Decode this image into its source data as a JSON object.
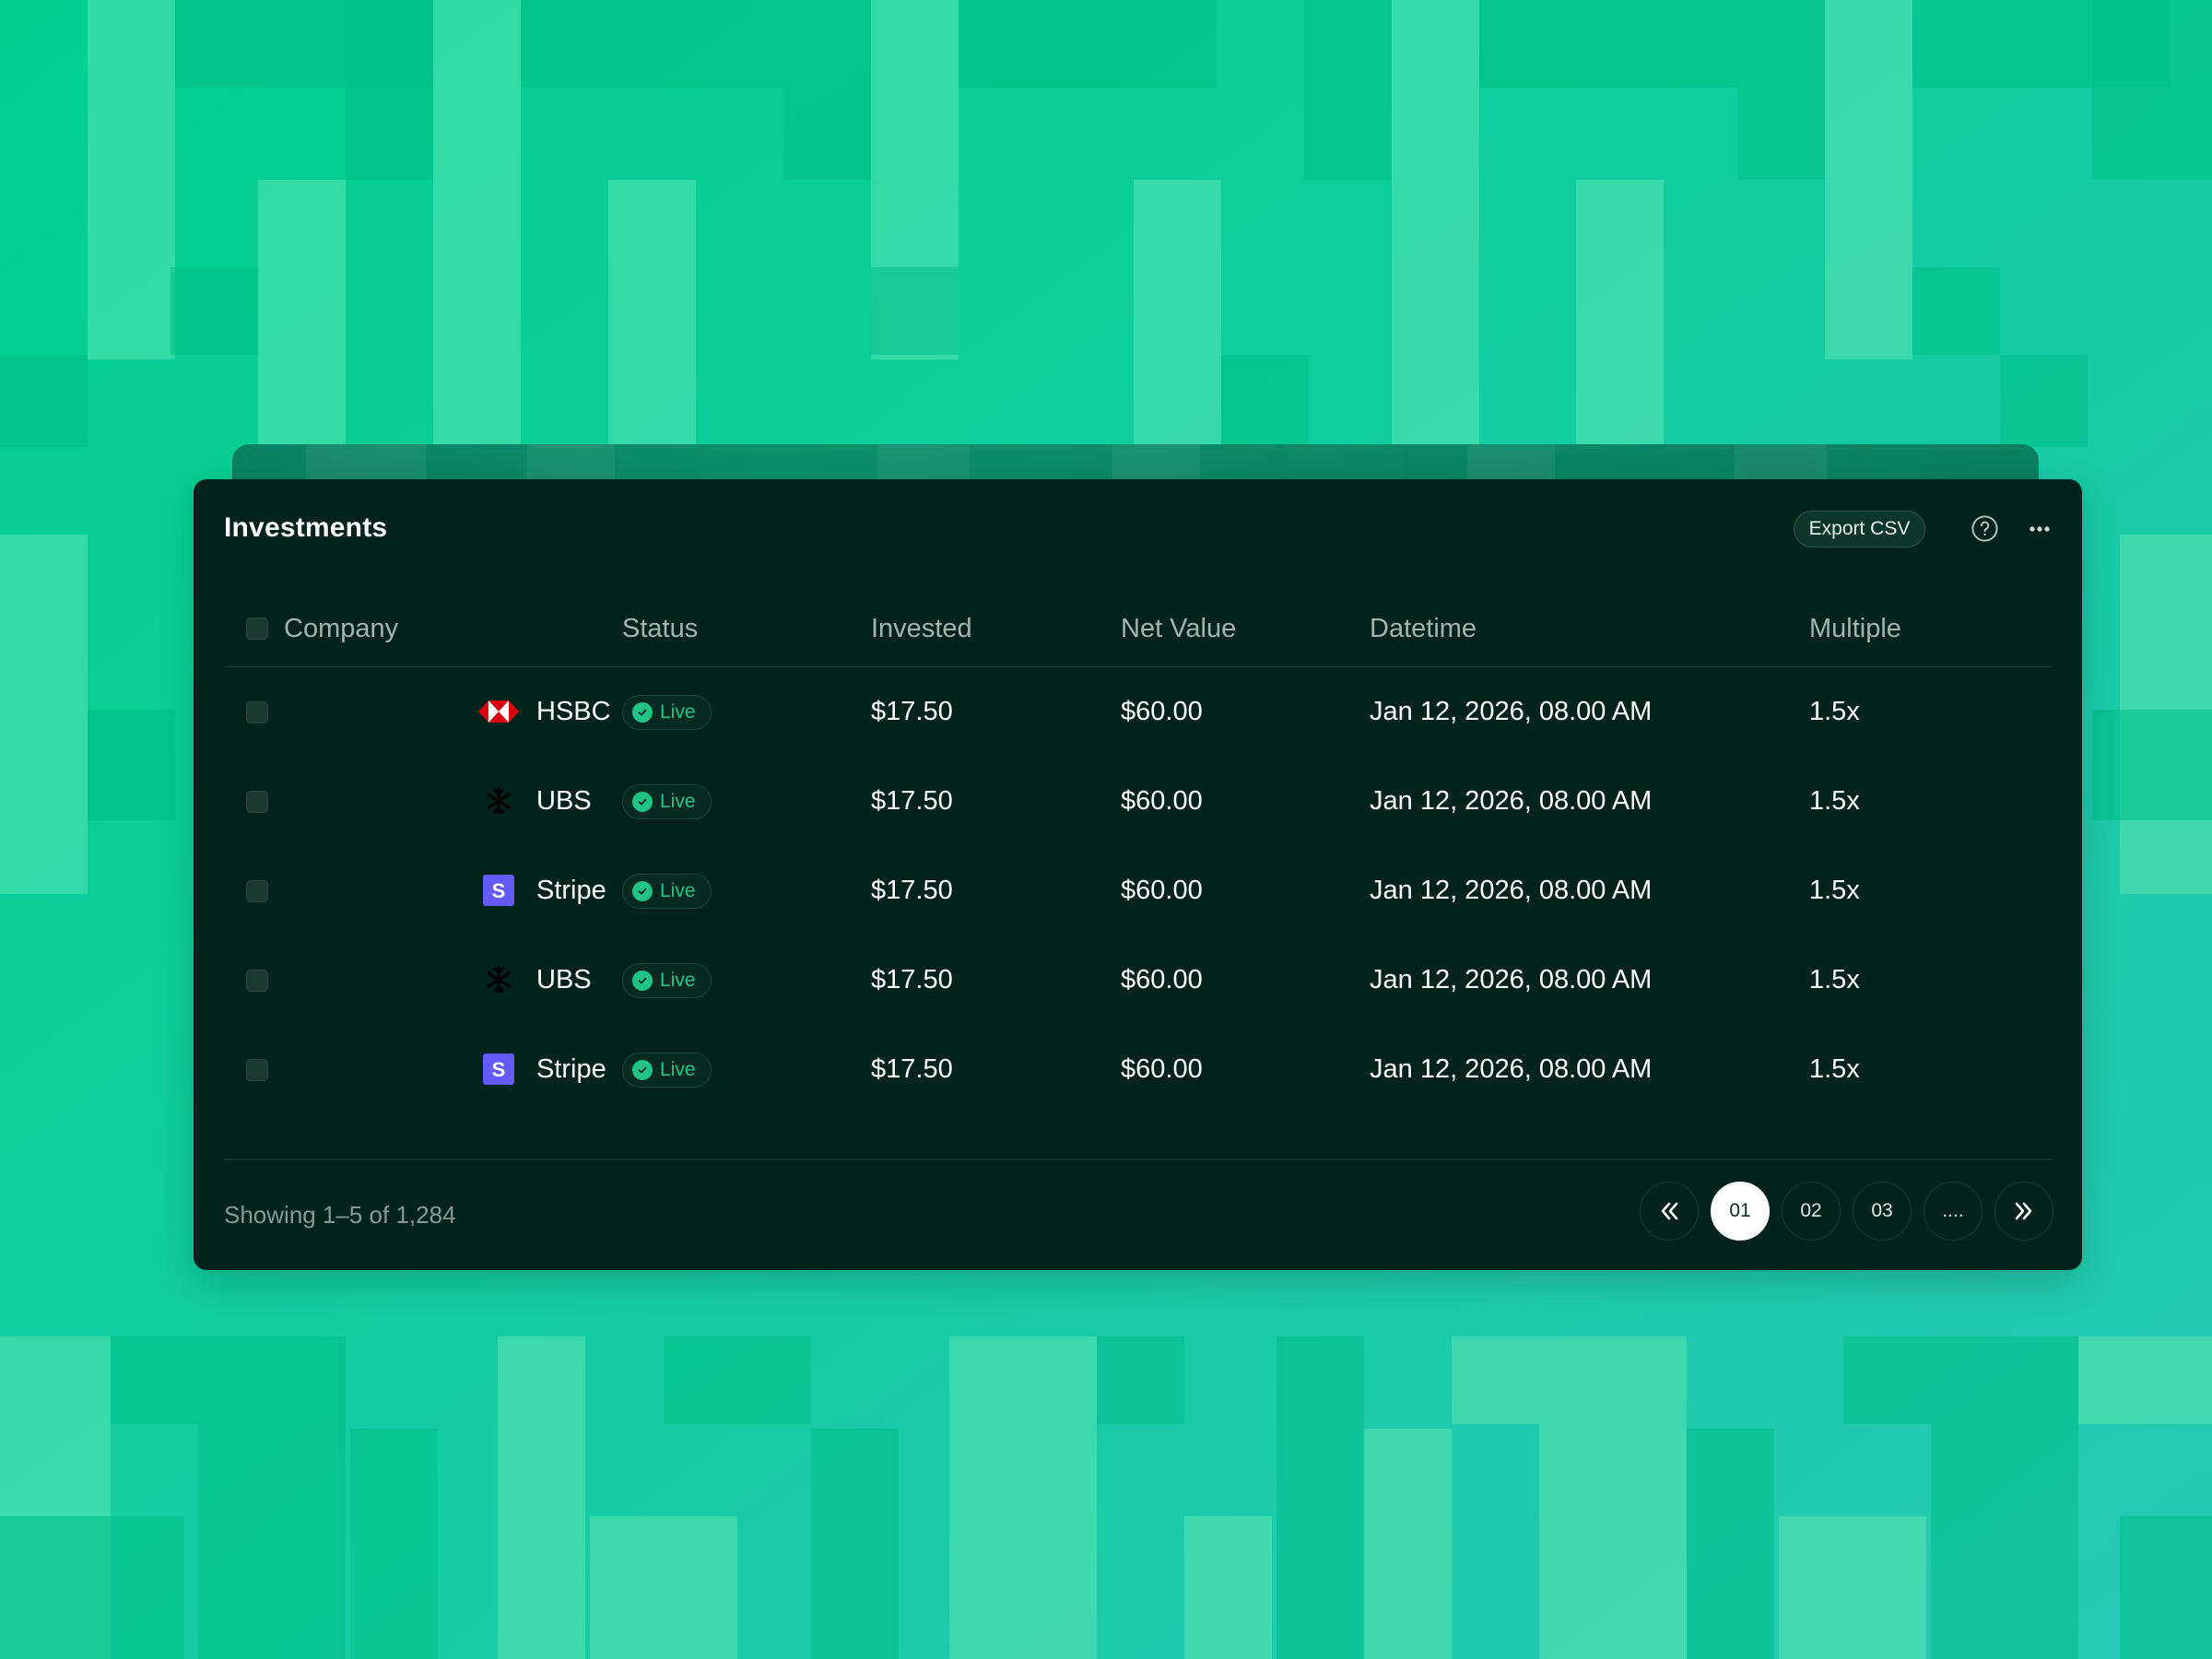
{
  "card": {
    "title": "Investments",
    "export_label": "Export CSV",
    "help_icon": "help-circle-icon",
    "more_icon": "more-horizontal-icon"
  },
  "table": {
    "columns": [
      "Company",
      "Status",
      "Invested",
      "Net Value",
      "Datetime",
      "Multiple"
    ],
    "rows": [
      {
        "company": "HSBC",
        "logo": "hsbc-logo-icon",
        "status": "Live",
        "invested": "$17.50",
        "net_value": "$60.00",
        "datetime": "Jan 12, 2026, 08.00 AM",
        "multiple": "1.5x"
      },
      {
        "company": "UBS",
        "logo": "ubs-logo-icon",
        "status": "Live",
        "invested": "$17.50",
        "net_value": "$60.00",
        "datetime": "Jan 12, 2026, 08.00 AM",
        "multiple": "1.5x"
      },
      {
        "company": "Stripe",
        "logo": "stripe-logo-icon",
        "status": "Live",
        "invested": "$17.50",
        "net_value": "$60.00",
        "datetime": "Jan 12, 2026, 08.00 AM",
        "multiple": "1.5x"
      },
      {
        "company": "UBS",
        "logo": "ubs-logo-icon",
        "status": "Live",
        "invested": "$17.50",
        "net_value": "$60.00",
        "datetime": "Jan 12, 2026, 08.00 AM",
        "multiple": "1.5x"
      },
      {
        "company": "Stripe",
        "logo": "stripe-logo-icon",
        "status": "Live",
        "invested": "$17.50",
        "net_value": "$60.00",
        "datetime": "Jan 12, 2026, 08.00 AM",
        "multiple": "1.5x"
      }
    ]
  },
  "footer": {
    "showing": "Showing 1–5 of 1,284",
    "pages": [
      "01",
      "02",
      "03",
      "...."
    ],
    "active_page": "01",
    "first_icon": "chevrons-left-icon",
    "last_icon": "chevrons-right-icon"
  },
  "colors": {
    "background": "#16cf97",
    "card": "#01231c",
    "accent_live": "#1fc486",
    "stripe": "#635bff",
    "hsbc": "#db0011"
  }
}
